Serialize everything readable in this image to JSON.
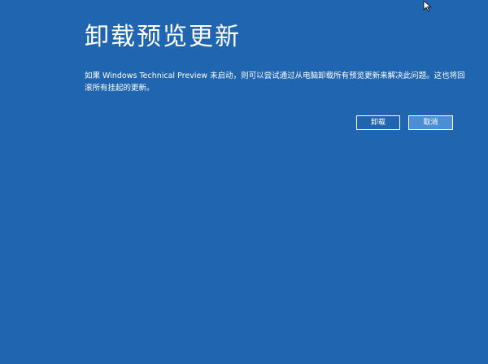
{
  "page": {
    "title": "卸载预览更新",
    "description": "如果 Windows Technical Preview 未启动，则可以尝试通过从电脑卸载所有预览更新来解决此问题。这也将回滚所有挂起的更新。"
  },
  "buttons": {
    "uninstall_label": "卸载",
    "cancel_label": "取消"
  },
  "colors": {
    "background": "#1f65b0",
    "cancel_button": "#4a8fd6",
    "text": "#ffffff"
  },
  "icons": {
    "cursor": "mouse-pointer-icon"
  }
}
